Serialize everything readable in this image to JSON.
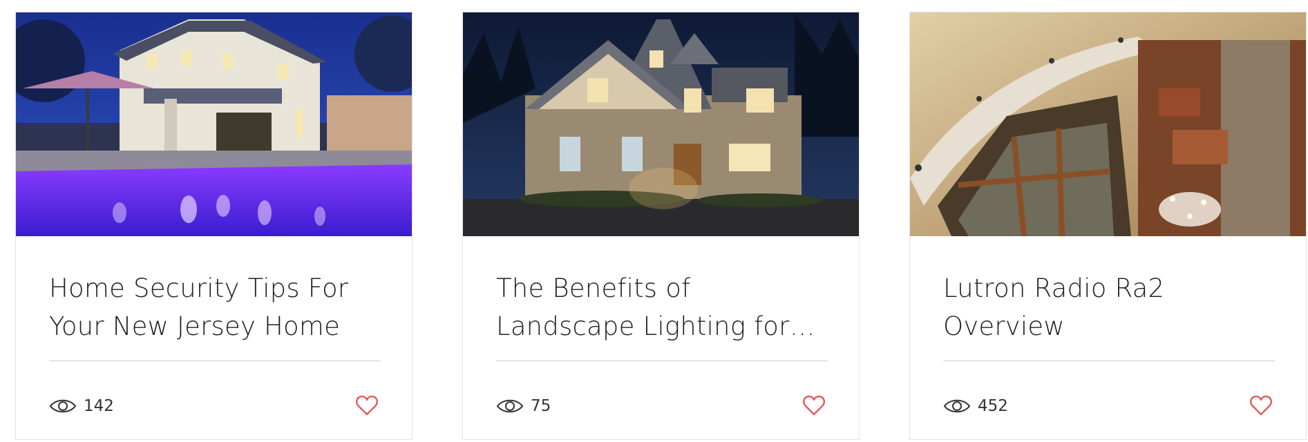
{
  "accent_color": "#e8585a",
  "view_icon": "eye-icon",
  "like_icon": "heart-icon",
  "posts": [
    {
      "title": "Home Security Tips For Your New Jersey Home",
      "views": "142",
      "image": "house-with-purple-lit-pool-at-night"
    },
    {
      "title": "The Benefits of Landscape Lighting for your New...",
      "views": "75",
      "image": "lit-house-facade-at-dusk"
    },
    {
      "title": "Lutron Radio Ra2 Overview",
      "views": "452",
      "image": "interior-ceiling-with-recessed-lights"
    }
  ]
}
